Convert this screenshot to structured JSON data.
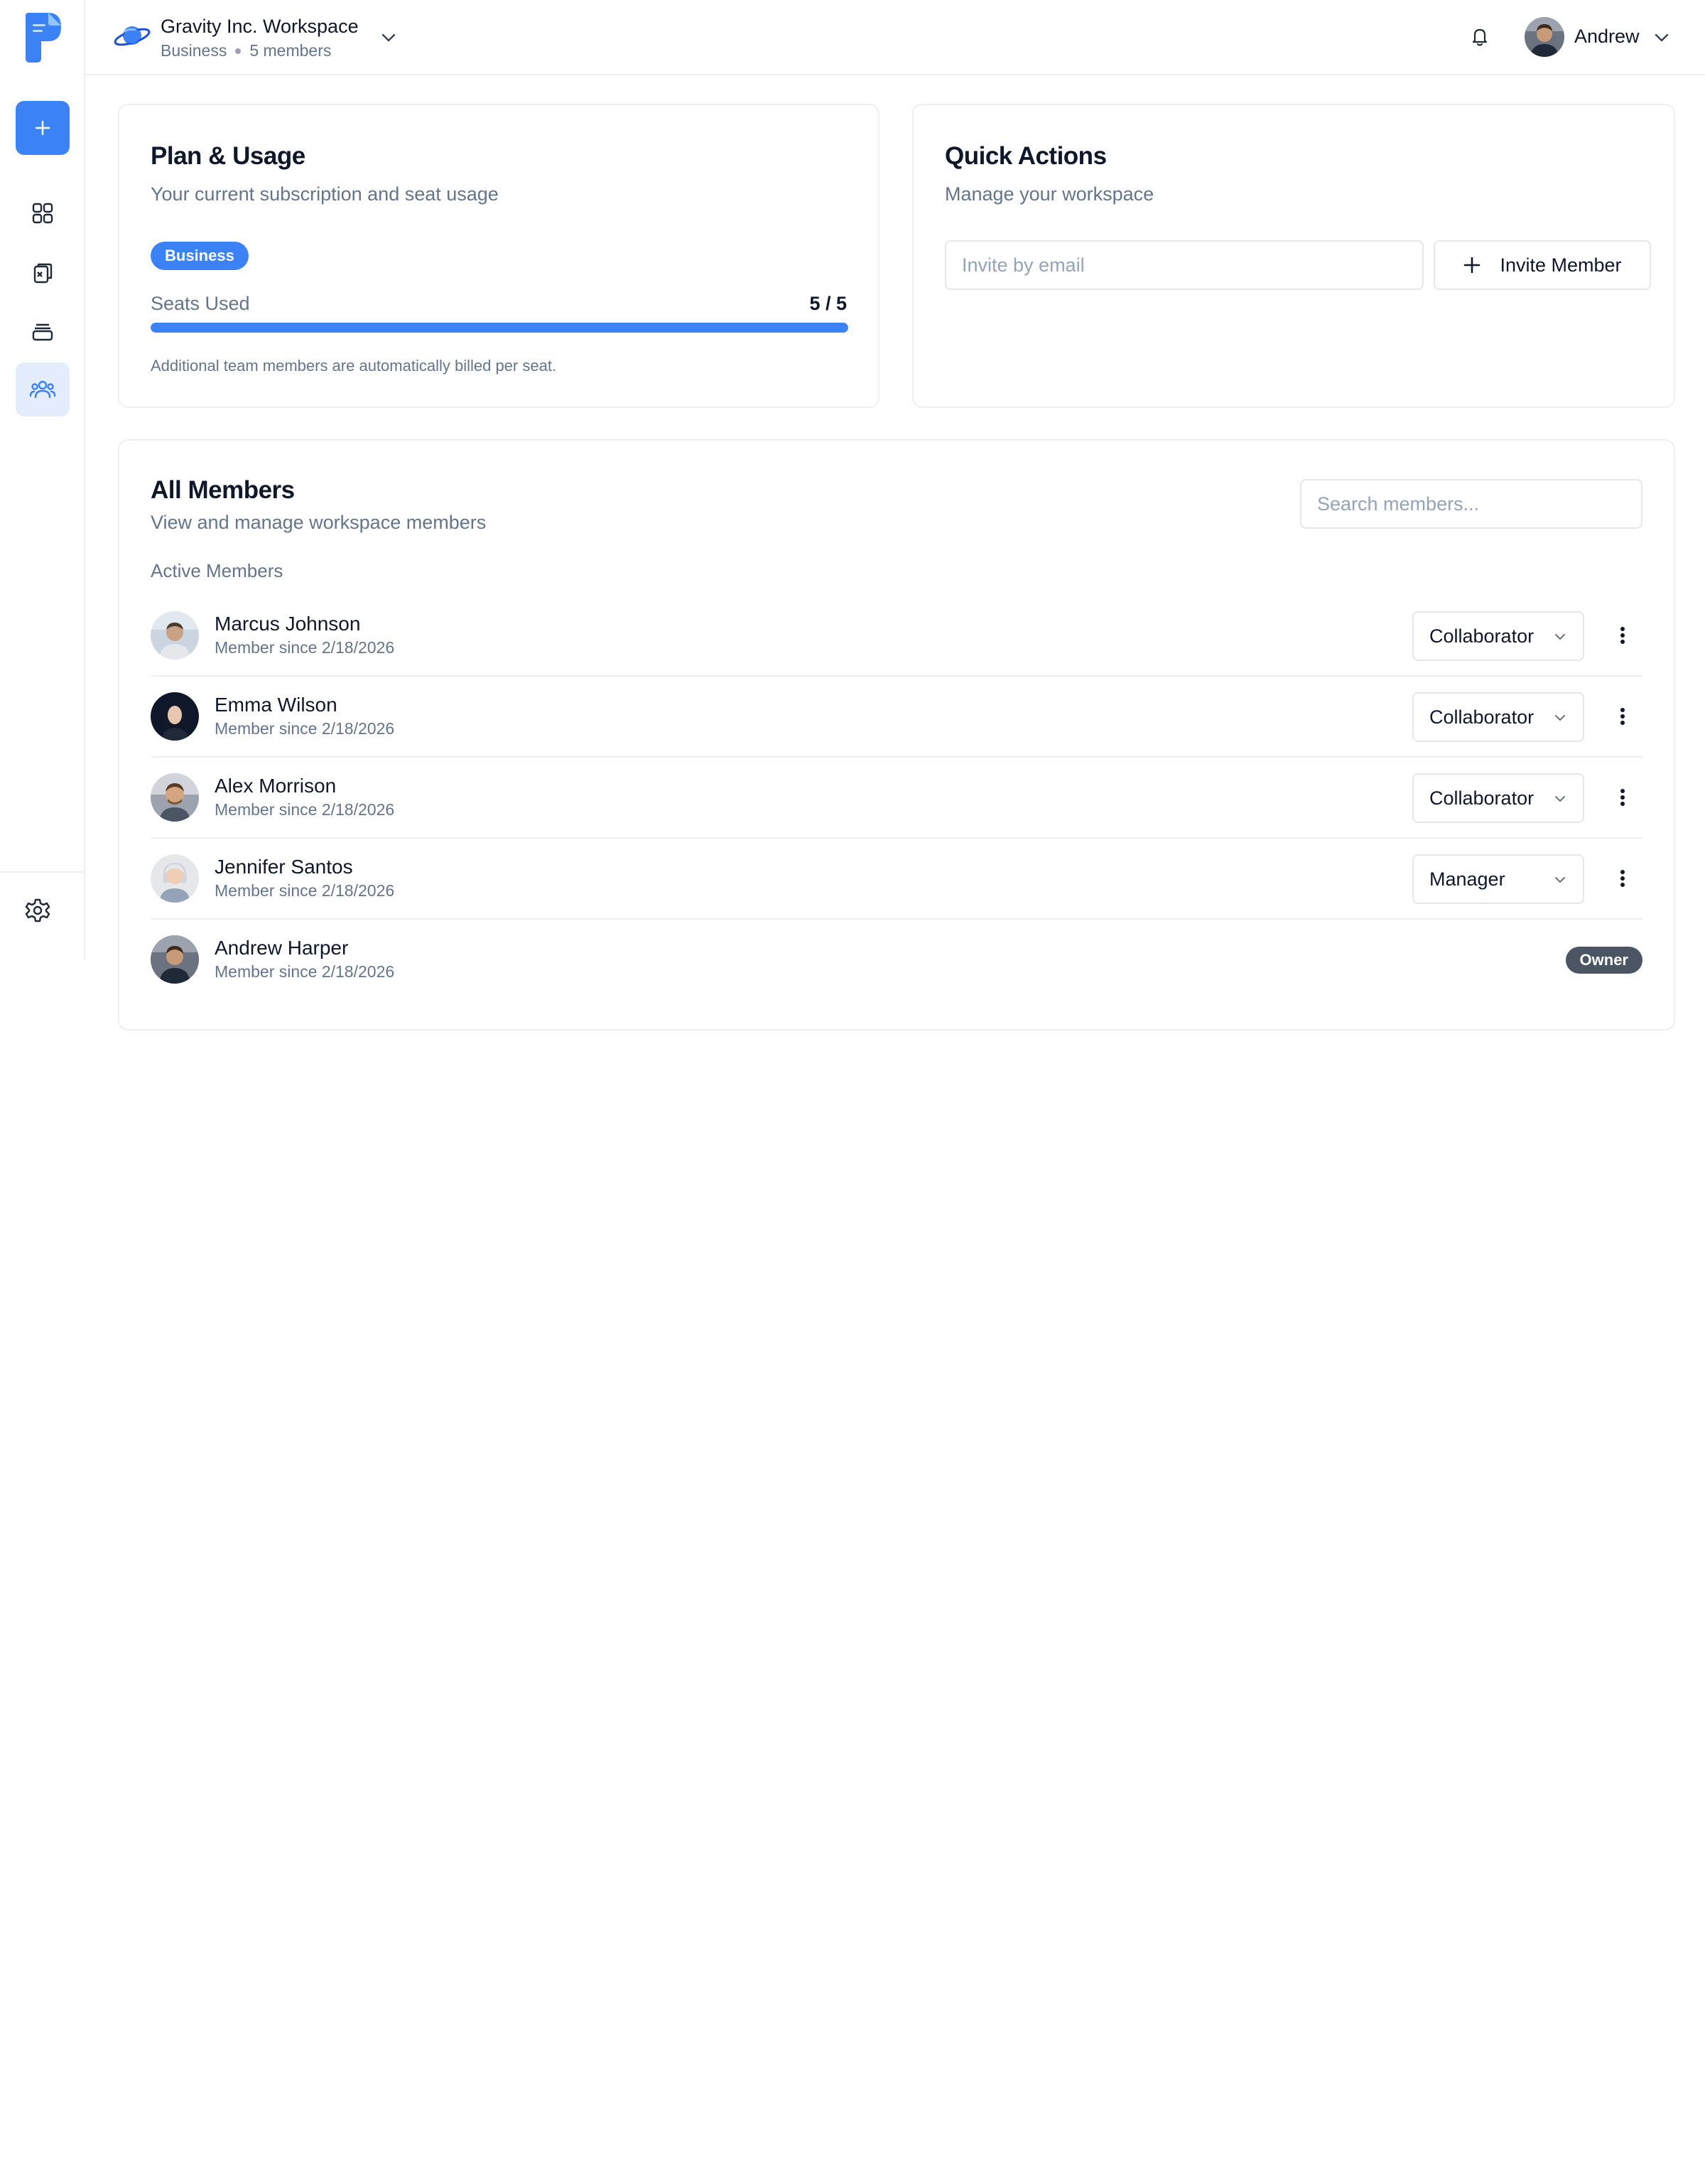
{
  "header": {
    "workspace_name": "Gravity Inc. Workspace",
    "workspace_plan": "Business",
    "workspace_members": "5 members",
    "user_name": "Andrew"
  },
  "sidebar": {
    "items": [
      {
        "icon": "grid-icon"
      },
      {
        "icon": "clipboard-icon"
      },
      {
        "icon": "archive-icon"
      },
      {
        "icon": "team-icon",
        "active": true
      }
    ]
  },
  "plan": {
    "title": "Plan & Usage",
    "subtitle": "Your current subscription and seat usage",
    "badge": "Business",
    "seats_label": "Seats Used",
    "seats_value": "5 / 5",
    "seats_used_fraction": 1.0,
    "note": "Additional team members are automatically billed per seat."
  },
  "quick_actions": {
    "title": "Quick Actions",
    "subtitle": "Manage your workspace",
    "invite_placeholder": "Invite by email",
    "invite_button": "Invite Member"
  },
  "members": {
    "title": "All Members",
    "subtitle": "View and manage workspace members",
    "search_placeholder": "Search members...",
    "section_label": "Active Members",
    "list": [
      {
        "name": "Marcus Johnson",
        "since": "Member since 2/18/2026",
        "role": "Collaborator"
      },
      {
        "name": "Emma Wilson",
        "since": "Member since 2/18/2026",
        "role": "Collaborator"
      },
      {
        "name": "Alex Morrison",
        "since": "Member since 2/18/2026",
        "role": "Collaborator"
      },
      {
        "name": "Jennifer Santos",
        "since": "Member since 2/18/2026",
        "role": "Manager"
      },
      {
        "name": "Andrew Harper",
        "since": "Member since 2/18/2026",
        "owner_badge": "Owner"
      }
    ]
  },
  "colors": {
    "accent": "#3b82f6",
    "active_nav_bg": "#e3edfd",
    "owner_badge": "#4b5563"
  }
}
